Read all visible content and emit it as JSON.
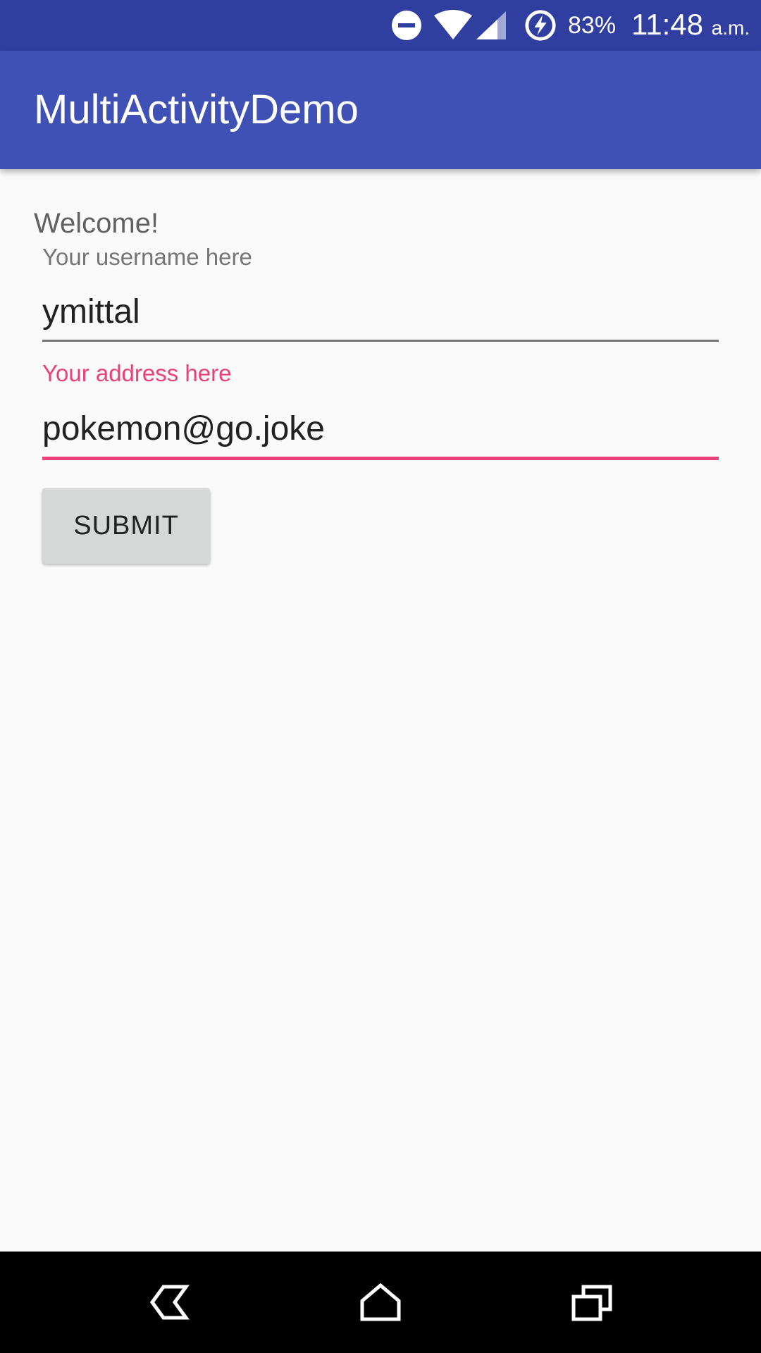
{
  "status_bar": {
    "battery_percent": "83%",
    "time": "11:48",
    "time_suffix": "a.m.",
    "icons": [
      "do-not-disturb-icon",
      "wifi-icon",
      "cell-signal-icon",
      "battery-charging-icon"
    ]
  },
  "app_bar": {
    "title": "MultiActivityDemo"
  },
  "main": {
    "welcome_text": "Welcome!",
    "username_label": "Your username here",
    "username_value": "ymittal",
    "address_label": "Your address here",
    "address_value": "pokemon@go.joke",
    "submit_label": "SUBMIT"
  },
  "nav_bar": {
    "icons": [
      "back-icon",
      "home-icon",
      "recents-icon"
    ]
  },
  "colors": {
    "status_bar": "#303f9f",
    "app_bar": "#3f51b5",
    "accent": "#ec407a",
    "background": "#fafafa",
    "button": "#d6d7d7"
  }
}
